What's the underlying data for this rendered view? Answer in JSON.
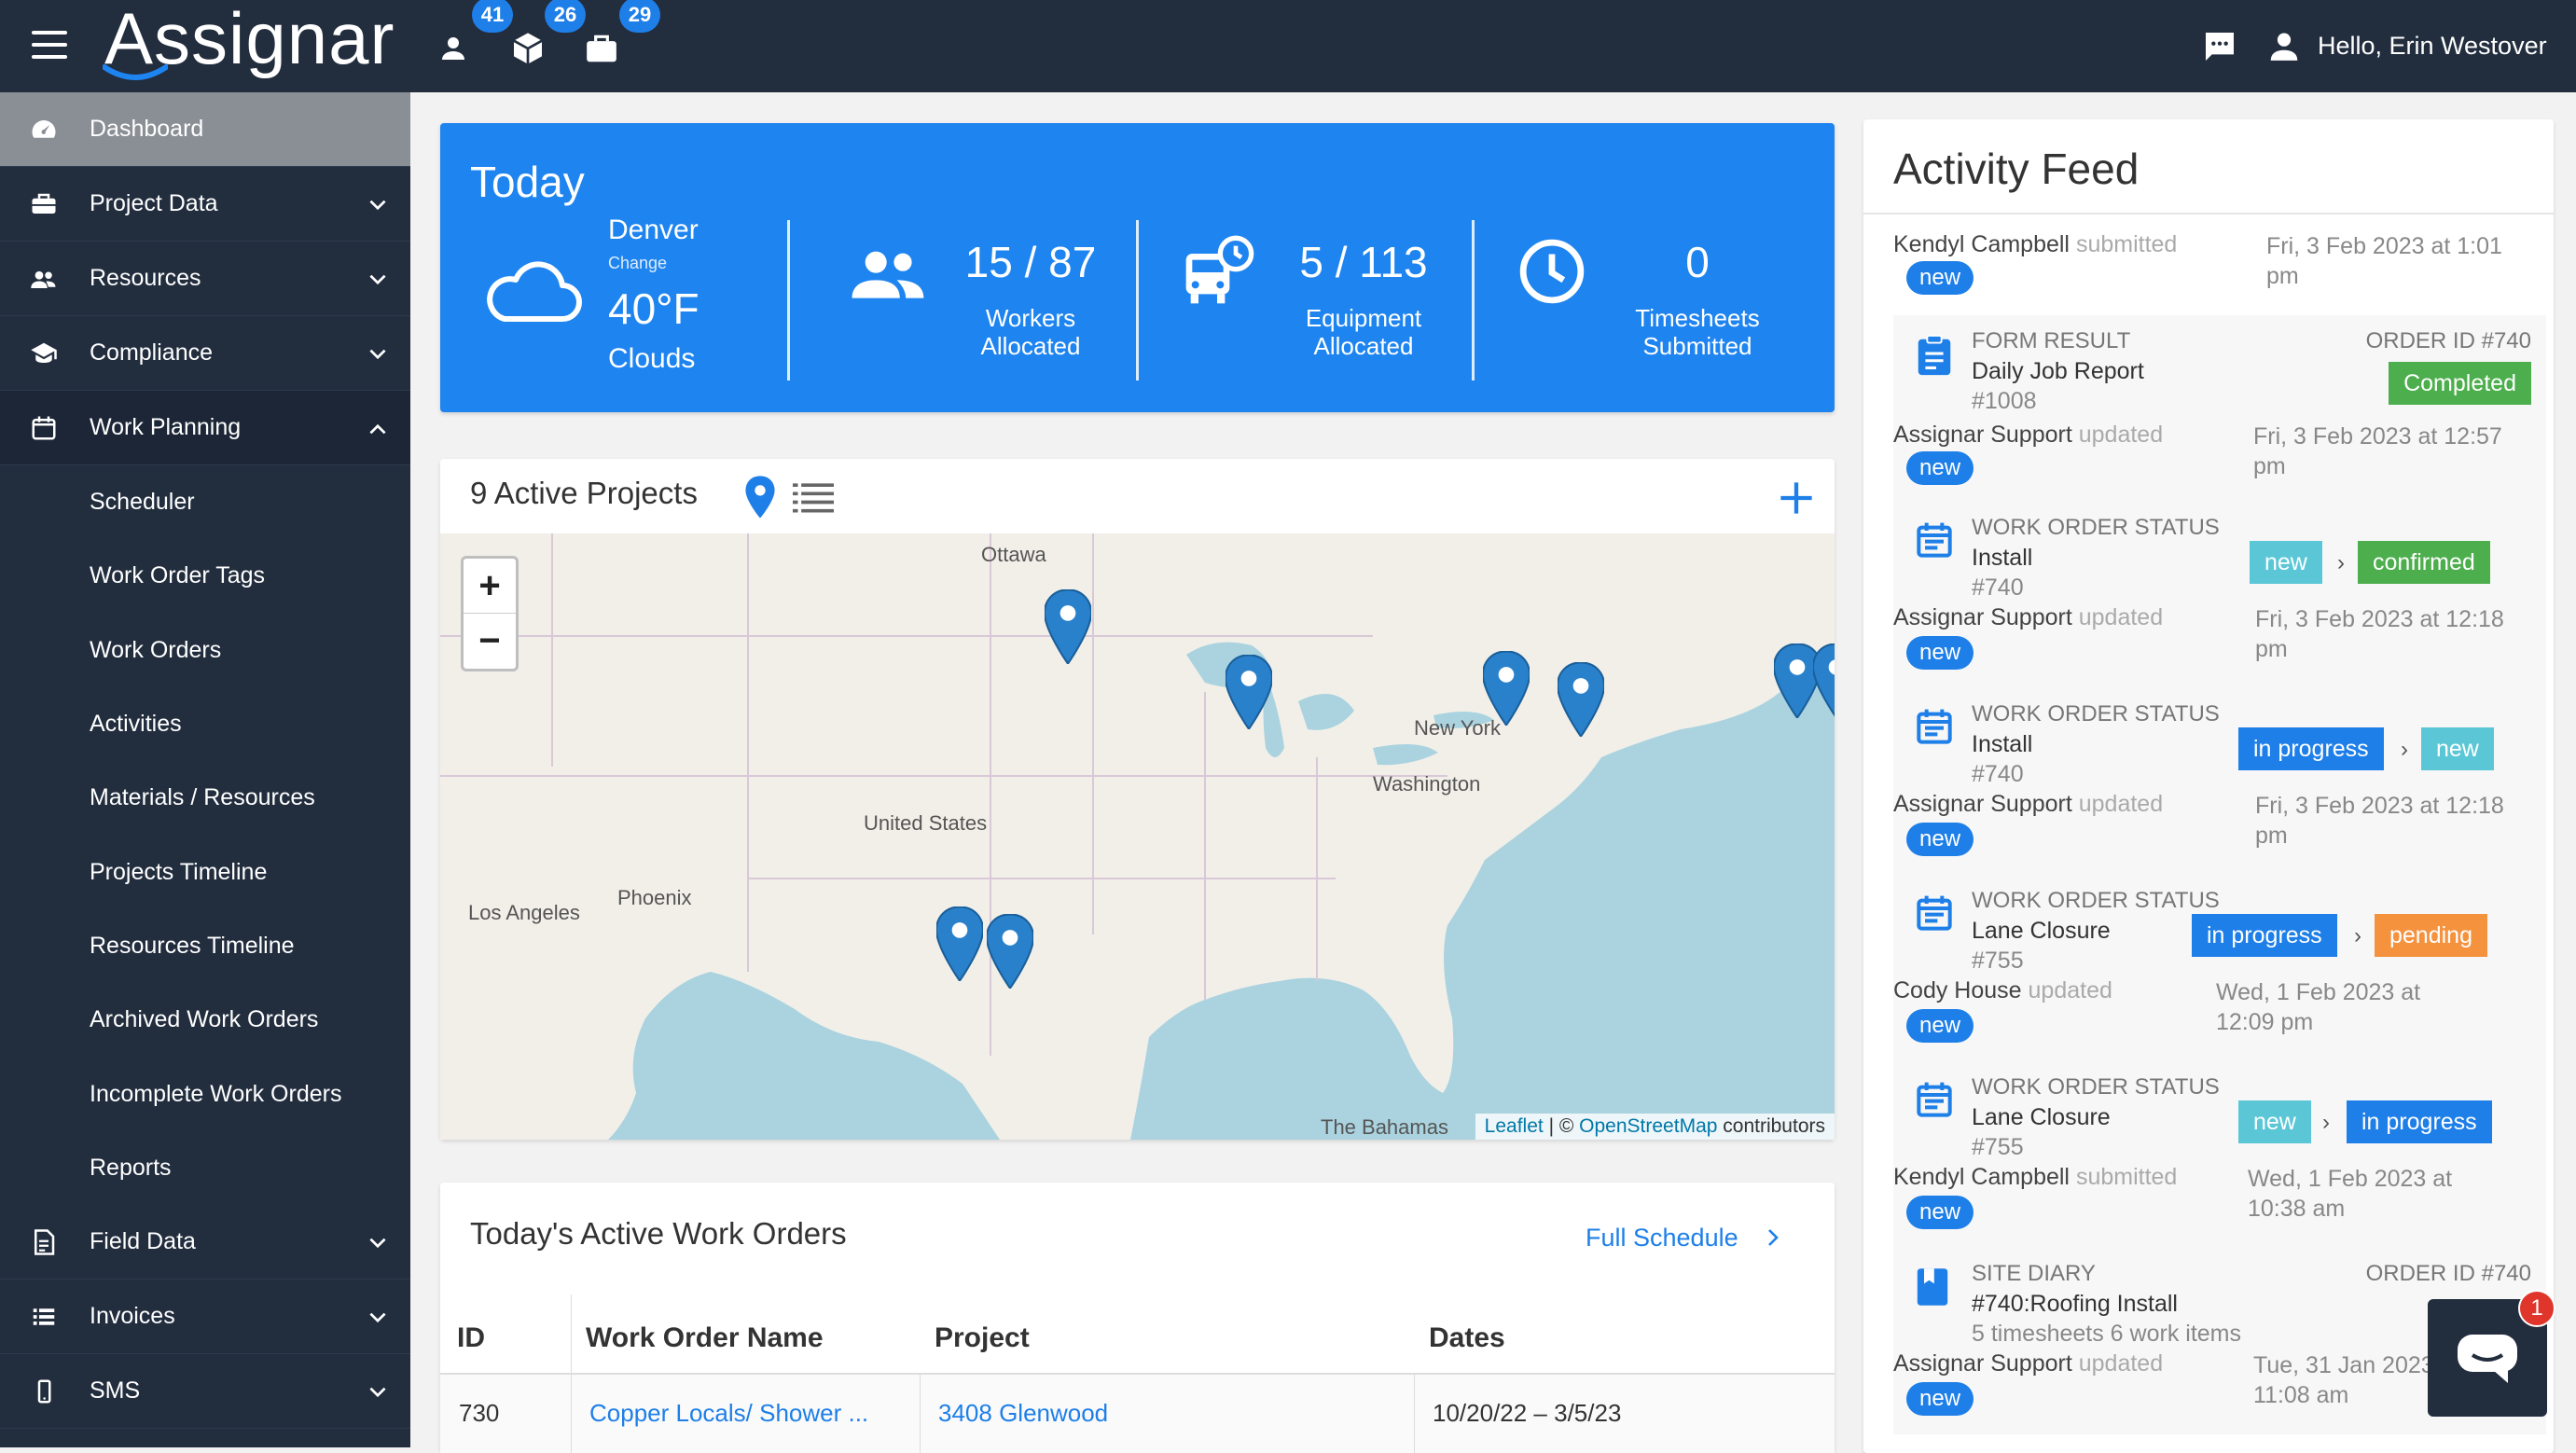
{
  "app": {
    "logo": "Assignar",
    "greeting": "Hello, Erin Westover"
  },
  "top_badges": [
    {
      "icon": "person-icon",
      "count": "41"
    },
    {
      "icon": "cube-icon",
      "count": "26"
    },
    {
      "icon": "briefcase-icon",
      "count": "29"
    }
  ],
  "sidebar": {
    "items": [
      {
        "label": "Dashboard",
        "icon": "dashboard-icon"
      },
      {
        "label": "Project Data",
        "icon": "briefcase-icon"
      },
      {
        "label": "Resources",
        "icon": "people-icon"
      },
      {
        "label": "Compliance",
        "icon": "graduation-cap-icon"
      },
      {
        "label": "Work Planning",
        "icon": "calendar-icon"
      }
    ],
    "sub_items": [
      "Scheduler",
      "Work Order Tags",
      "Work Orders",
      "Activities",
      "Materials / Resources",
      "Projects Timeline",
      "Resources Timeline",
      "Archived Work Orders",
      "Incomplete Work Orders",
      "Reports"
    ],
    "bottom_items": [
      {
        "label": "Field Data",
        "icon": "document-icon"
      },
      {
        "label": "Invoices",
        "icon": "list-icon"
      },
      {
        "label": "SMS",
        "icon": "phone-icon"
      }
    ]
  },
  "today": {
    "title": "Today",
    "city": "Denver",
    "change": "Change",
    "temp": "40°F",
    "condition": "Clouds",
    "stats": [
      {
        "value": "15 / 87",
        "label1": "Workers",
        "label2": "Allocated"
      },
      {
        "value": "5 / 113",
        "label1": "Equipment",
        "label2": "Allocated"
      },
      {
        "value": "0",
        "label1": "Timesheets",
        "label2": "Submitted"
      }
    ]
  },
  "projects": {
    "title": "9 Active Projects",
    "map_labels": [
      "Ottawa",
      "New York",
      "Washington",
      "United States",
      "Phoenix",
      "Los Angeles",
      "The Bahamas"
    ],
    "attribution_leaflet": "Leaflet",
    "attribution_sep": " | © ",
    "attribution_osm": "OpenStreetMap",
    "attribution_tail": " contributors"
  },
  "work_orders": {
    "title": "Today's Active Work Orders",
    "full_schedule": "Full Schedule",
    "columns": [
      "ID",
      "Work Order Name",
      "Project",
      "Dates"
    ],
    "rows": [
      {
        "id": "730",
        "name": "Copper Locals/ Shower ...",
        "project": "3408 Glenwood",
        "dates": "10/20/22 – 3/5/23"
      }
    ]
  },
  "feed": {
    "title": "Activity Feed",
    "entries": [
      {
        "by": "Kendyl Campbell",
        "action": "submitted",
        "date": "Fri, 3 Feb 2023 at 1:01 pm",
        "pill": "new"
      },
      {
        "kind": "FORM RESULT",
        "name": "Daily Job Report",
        "num": "#1008",
        "order": "ORDER ID #740",
        "tags": [
          "Completed"
        ],
        "by": "Assignar Support",
        "action": "updated",
        "date": "Fri, 3 Feb 2023 at 12:57 pm",
        "pill": "new"
      },
      {
        "kind": "WORK ORDER STATUS",
        "name": "Install",
        "num": "#740",
        "tags": [
          "new",
          "confirmed"
        ],
        "by": "Assignar Support",
        "action": "updated",
        "date": "Fri, 3 Feb 2023 at 12:18 pm",
        "pill": "new"
      },
      {
        "kind": "WORK ORDER STATUS",
        "name": "Install",
        "num": "#740",
        "tags": [
          "in progress",
          "new"
        ],
        "by": "Assignar Support",
        "action": "updated",
        "date": "Fri, 3 Feb 2023 at 12:18 pm",
        "pill": "new"
      },
      {
        "kind": "WORK ORDER STATUS",
        "name": "Lane Closure",
        "num": "#755",
        "tags": [
          "in progress",
          "pending"
        ],
        "by": "Cody House",
        "action": "updated",
        "date": "Wed, 1 Feb 2023 at 12:09 pm",
        "pill": "new"
      },
      {
        "kind": "WORK ORDER STATUS",
        "name": "Lane Closure",
        "num": "#755",
        "tags": [
          "new",
          "in progress"
        ],
        "by": "Kendyl Campbell",
        "action": "submitted",
        "date": "Wed, 1 Feb 2023 at 10:38 am",
        "pill": "new"
      },
      {
        "kind": "SITE DIARY",
        "name": "#740:Roofing Install",
        "num": "5 timesheets 6 work items",
        "order": "ORDER ID #740",
        "by": "Assignar Support",
        "action": "updated",
        "date": "Tue, 31 Jan 2023 at 11:08 am",
        "pill": "new"
      }
    ]
  },
  "chat_widget": {
    "badge": "1"
  },
  "colors": {
    "nav": "#222d3e",
    "accent": "#1e84f0",
    "green": "#4cae4c",
    "teal": "#5bc7d6",
    "orange": "#f5923e"
  }
}
